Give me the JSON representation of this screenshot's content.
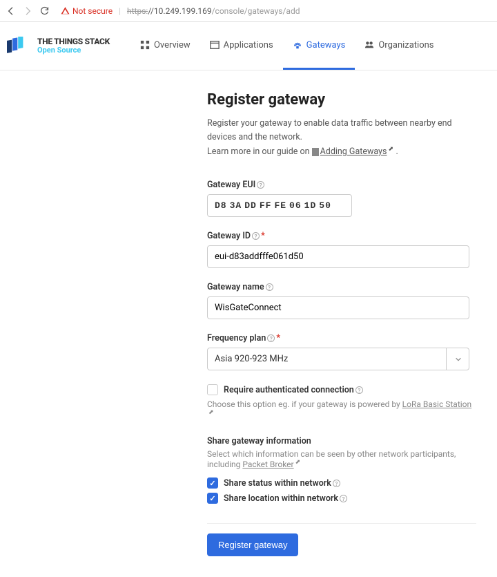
{
  "browser": {
    "not_secure": "Not secure",
    "url_scheme": "https:",
    "url_host": "//10.249.199.169",
    "url_path": "/console/gateways/add"
  },
  "logo": {
    "line1": "THE THINGS STACK",
    "line2": "Open Source"
  },
  "nav": {
    "overview": "Overview",
    "applications": "Applications",
    "gateways": "Gateways",
    "organizations": "Organizations"
  },
  "page": {
    "title": "Register gateway",
    "subtitle_1": "Register your gateway to enable data traffic between nearby end devices and the network.",
    "subtitle_2a": "Learn more in our guide on ",
    "subtitle_link": "Adding Gateways",
    "subtitle_2b": " ."
  },
  "form": {
    "eui_label": "Gateway EUI",
    "eui": [
      "D8",
      "3A",
      "DD",
      "FF",
      "FE",
      "06",
      "1D",
      "50"
    ],
    "id_label": "Gateway ID",
    "id_value": "eui-d83addfffe061d50",
    "name_label": "Gateway name",
    "name_value": "WisGateConnect",
    "freq_label": "Frequency plan",
    "freq_value": "Asia 920-923 MHz",
    "auth_label": "Require authenticated connection",
    "auth_help": "Choose this option eg. if your gateway is powered by ",
    "auth_link": "LoRa Basic Station",
    "share_title": "Share gateway information",
    "share_help": "Select which information can be seen by other network participants, including ",
    "share_link": "Packet Broker",
    "share_status": "Share status within network",
    "share_location": "Share location within network",
    "submit": "Register gateway"
  }
}
